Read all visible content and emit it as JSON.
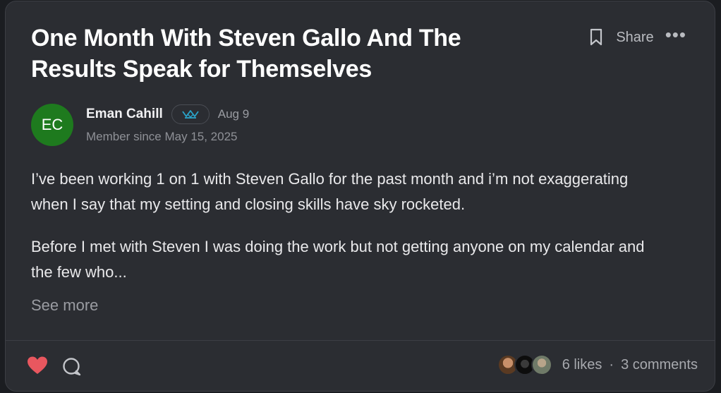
{
  "post": {
    "title": "One Month With Steven Gallo And The Results Speak for Themselves",
    "share_label": "Share",
    "more_label": "•••",
    "author": {
      "initials": "EC",
      "name": "Eman Cahill",
      "date": "Aug 9",
      "member_since": "Member since May 15, 2025",
      "avatar_color": "#1e7a1e"
    },
    "body": [
      "I’ve been working 1 on 1 with Steven Gallo for the past month and i’m not exaggerating when I say that my setting and closing skills have sky rocketed.",
      "Before I met with Steven I was doing the work but not getting anyone on my calendar and the few who..."
    ],
    "see_more_label": "See more",
    "likes_label": "6 likes",
    "separator": "·",
    "comments_label": "3 comments",
    "icons": {
      "bookmark": "bookmark-icon",
      "heart": "heart-icon",
      "comment": "comment-icon",
      "badge": "crown-badge-icon"
    },
    "colors": {
      "heart": "#e8575f",
      "badge": "#2aa3c9",
      "background": "#2b2d32"
    }
  }
}
